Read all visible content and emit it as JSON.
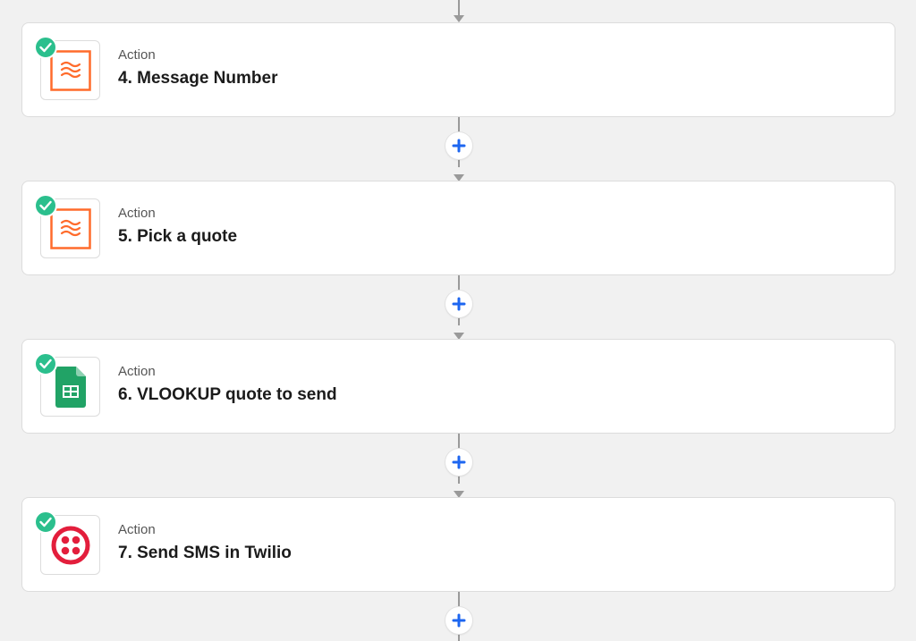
{
  "colors": {
    "background": "#f1f1f1",
    "card": "#ffffff",
    "connector": "#9a9a9a",
    "add_button_plus": "#1d66f0",
    "check_badge": "#2bbf8d",
    "formatter_orange": "#ff6b2b",
    "sheets_green": "#21a366",
    "twilio_red": "#e31e3c"
  },
  "steps": [
    {
      "type": "Action",
      "title": "4. Message Number",
      "icon": "formatter-icon",
      "status": "completed-check-icon"
    },
    {
      "type": "Action",
      "title": "5. Pick a quote",
      "icon": "formatter-icon",
      "status": "completed-check-icon"
    },
    {
      "type": "Action",
      "title": "6. VLOOKUP quote to send",
      "icon": "google-sheets-icon",
      "status": "completed-check-icon"
    },
    {
      "type": "Action",
      "title": "7. Send SMS in Twilio",
      "icon": "twilio-icon",
      "status": "completed-check-icon"
    }
  ],
  "add_step_button": {
    "icon": "plus-icon"
  }
}
